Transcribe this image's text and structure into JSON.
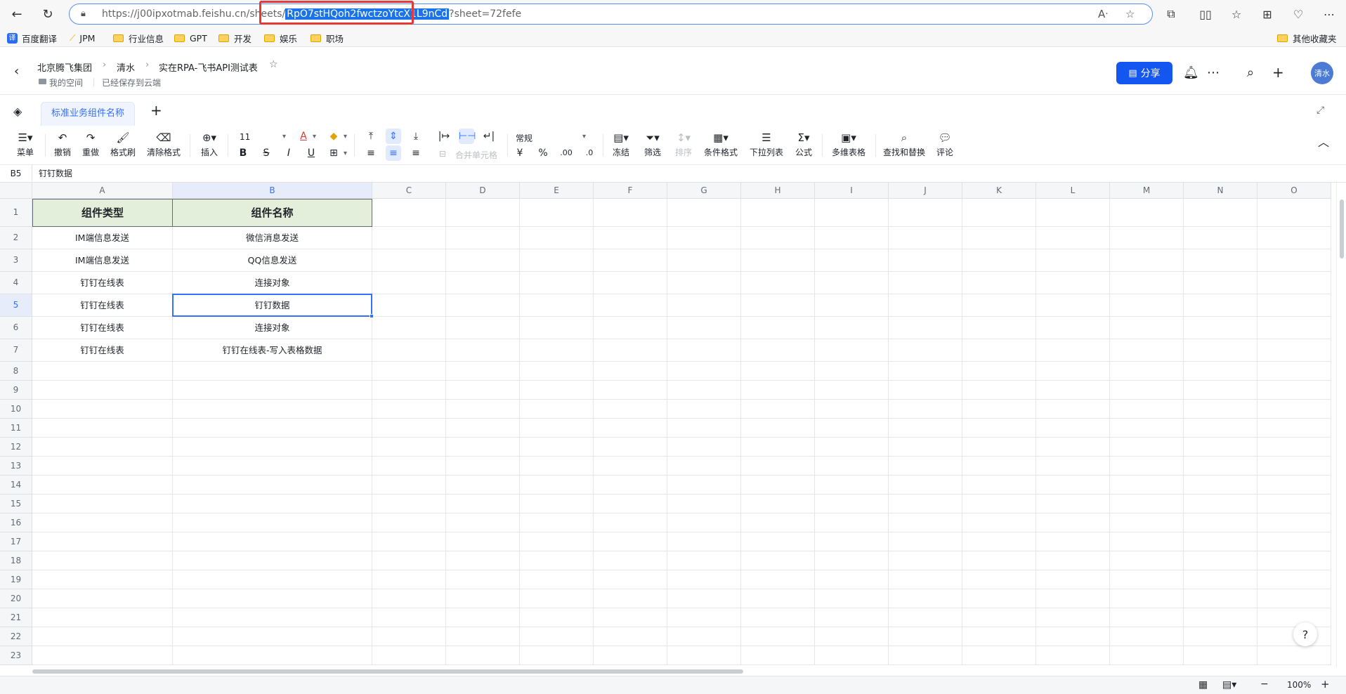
{
  "browser": {
    "url_prefix": "https://j00ipxotmab.feishu.cn/sheets/",
    "url_selected": "RpO7stHQoh2fwctzoYtcX1L9nCd",
    "url_suffix": "?sheet=72fefe",
    "bookmarks": [
      "百度翻译",
      "JPM",
      "行业信息",
      "GPT",
      "开发",
      "娱乐",
      "职场"
    ],
    "other_bookmarks": "其他收藏夹"
  },
  "header": {
    "crumbs": [
      "北京腾飞集团",
      "清水",
      "实在RPA-飞书API测试表"
    ],
    "location": "我的空间",
    "save_status": "已经保存到云端",
    "share_label": "分享",
    "avatar_text": "清水"
  },
  "sheet_tab": {
    "active_label": "标准业务组件名称",
    "add_label": "+"
  },
  "toolbar": {
    "menu": "菜单",
    "undo": "撤销",
    "redo": "重做",
    "format_painter": "格式刷",
    "clear_format": "清除格式",
    "insert": "插入",
    "font_size": "11",
    "merge": "合并单元格",
    "number_format": "常规",
    "freeze": "冻结",
    "filter": "筛选",
    "sort": "排序",
    "conditional": "条件格式",
    "dropdown": "下拉列表",
    "formula": "公式",
    "multi_table": "多维表格",
    "find_replace": "查找和替换",
    "comment": "评论"
  },
  "formula_bar": {
    "cell_ref": "B5",
    "value": "钉钉数据"
  },
  "grid": {
    "columns": [
      "A",
      "B",
      "C",
      "D",
      "E",
      "F",
      "G",
      "H",
      "I",
      "J",
      "K",
      "L",
      "M",
      "N",
      "O"
    ],
    "rows": [
      "1",
      "2",
      "3",
      "4",
      "5",
      "6",
      "7",
      "8",
      "9",
      "10",
      "11",
      "12",
      "13",
      "14",
      "15",
      "16",
      "17",
      "18",
      "19",
      "20",
      "21",
      "22",
      "23"
    ],
    "cells": [
      [
        "组件类型",
        "组件名称"
      ],
      [
        "IM端信息发送",
        "微信消息发送"
      ],
      [
        "IM端信息发送",
        "QQ信息发送"
      ],
      [
        "钉钉在线表",
        "连接对象"
      ],
      [
        "钉钉在线表",
        "钉钉数据"
      ],
      [
        "钉钉在线表",
        "连接对象"
      ],
      [
        "钉钉在线表",
        "钉钉在线表-写入表格数据"
      ]
    ]
  },
  "status": {
    "zoom": "100%"
  }
}
